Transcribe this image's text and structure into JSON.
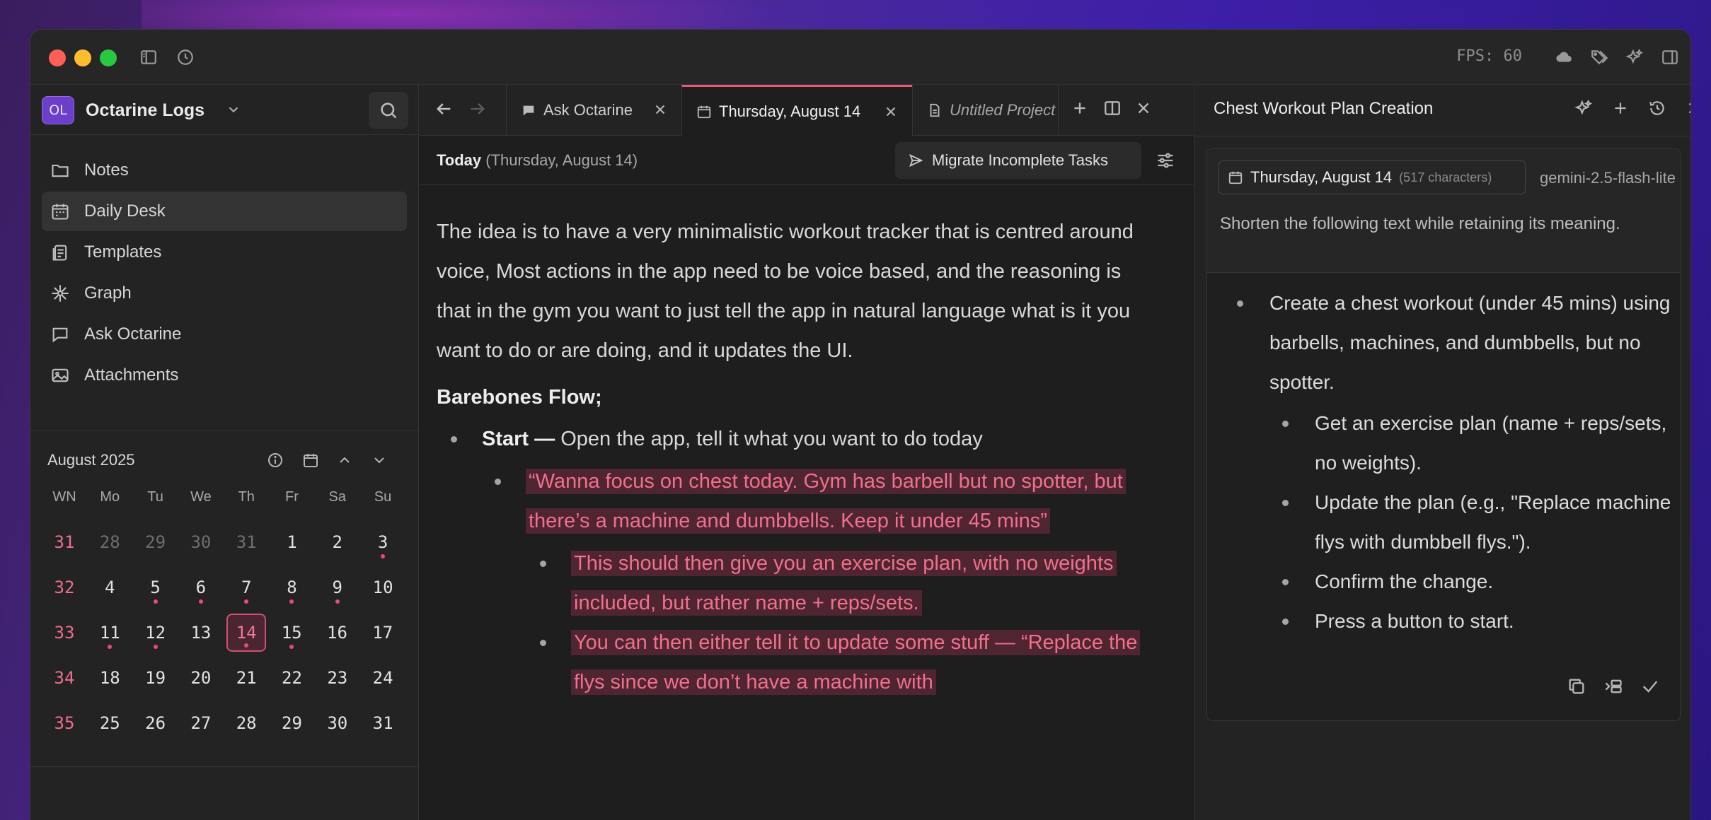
{
  "titlebar": {
    "fps_label": "FPS: 60"
  },
  "workspace": {
    "avatar_initials": "OL",
    "name": "Octarine Logs"
  },
  "sidebar": {
    "items": [
      {
        "label": "Notes",
        "icon": "folder-icon",
        "active": false
      },
      {
        "label": "Daily Desk",
        "icon": "calendar-icon",
        "active": true
      },
      {
        "label": "Templates",
        "icon": "templates-icon",
        "active": false
      },
      {
        "label": "Graph",
        "icon": "graph-icon",
        "active": false
      },
      {
        "label": "Ask Octarine",
        "icon": "chat-icon",
        "active": false
      },
      {
        "label": "Attachments",
        "icon": "image-icon",
        "active": false
      }
    ]
  },
  "calendar": {
    "title": "August 2025",
    "headers": [
      "WN",
      "Mo",
      "Tu",
      "We",
      "Th",
      "Fr",
      "Sa",
      "Su"
    ],
    "weeks": [
      {
        "wn": "31",
        "days": [
          "28",
          "29",
          "30",
          "31",
          "1",
          "2",
          "3"
        ]
      },
      {
        "wn": "32",
        "days": [
          "4",
          "5",
          "6",
          "7",
          "8",
          "9",
          "10"
        ]
      },
      {
        "wn": "33",
        "days": [
          "11",
          "12",
          "13",
          "14",
          "15",
          "16",
          "17"
        ]
      },
      {
        "wn": "34",
        "days": [
          "18",
          "19",
          "20",
          "21",
          "22",
          "23",
          "24"
        ]
      },
      {
        "wn": "35",
        "days": [
          "25",
          "26",
          "27",
          "28",
          "29",
          "30",
          "31"
        ]
      }
    ],
    "today": "14",
    "accent": "#e84c73"
  },
  "tabs": [
    {
      "label": "Ask Octarine",
      "icon": "chat-icon",
      "active": false
    },
    {
      "label": "Thursday, August 14",
      "icon": "calendar-icon",
      "active": true
    },
    {
      "label": "Untitled Project",
      "icon": "document-icon",
      "active": false
    }
  ],
  "doc_header": {
    "today_bold": "Today",
    "today_date": "(Thursday, August 14)",
    "migrate_label": "Migrate Incomplete Tasks"
  },
  "doc": {
    "intro": "The idea is to have a very minimalistic workout tracker that is centred around voice, Most actions in the app need to be voice based, and the reasoning is that in the gym you want to just tell the app in natural language what is it you want to do or are doing, and it updates the UI.",
    "heading": "Barebones Flow;",
    "start_bold": "Start —",
    "start_text": "Open the app, tell it what you want to do today",
    "quote": "“Wanna focus on chest today. Gym has barbell but no spotter, but there’s a machine and dumbbells. Keep it under 45 mins”",
    "sub1": "This should then give you an exercise plan, with no weights included, but rather name + reps/sets.",
    "sub2": "You can then either tell it to update some stuff — “Replace the flys since we don’t have a machine with"
  },
  "right_pane": {
    "title": "Chest Workout Plan Creation",
    "context_date": "Thursday, August 14",
    "context_chars": "(517 characters)",
    "model": "gemini-2.5-flash-lite",
    "prompt": "Shorten the following text while retaining its meaning.",
    "response": {
      "main": "Create a chest workout (under 45 mins) using barbells, machines, and dumbbells, but no spotter.",
      "subs": [
        "Get an exercise plan (name + reps/sets, no weights).",
        "Update the plan (e.g., \"Replace machine flys with dumbbell flys.\").",
        "Confirm the change.",
        "Press a button to start."
      ]
    }
  }
}
